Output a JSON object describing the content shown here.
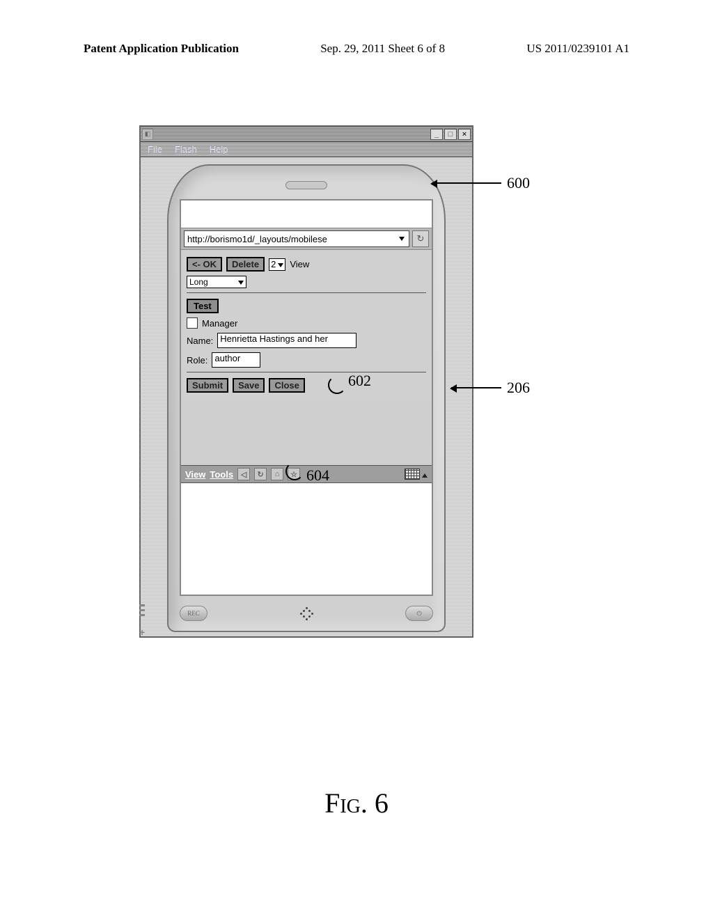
{
  "page_header": {
    "left": "Patent Application Publication",
    "center": "Sep. 29, 2011   Sheet 6 of 8",
    "right": "US 2011/0239101 A1"
  },
  "emulator": {
    "menu": {
      "file": "File",
      "flash": "Flash",
      "help": "Help"
    },
    "address": "http://borismo1d/_layouts/mobilese",
    "toolbar": {
      "ok": "<- OK",
      "delete": "Delete",
      "view_count": "2",
      "view_label": "View",
      "long": "Long"
    },
    "form": {
      "test": "Test",
      "manager_label": "Manager",
      "name_label": "Name:",
      "name_value": "Henrietta Hastings and her",
      "role_label": "Role:",
      "role_value": "author"
    },
    "actions": {
      "submit": "Submit",
      "save": "Save",
      "close": "Close"
    },
    "viewtools": {
      "view": "View",
      "tools": "Tools"
    },
    "hw": {
      "rec": "REC"
    }
  },
  "callouts": {
    "c600": "600",
    "c206": "206",
    "c602": "602",
    "c604": "604"
  },
  "figure_caption": "Fig. 6"
}
